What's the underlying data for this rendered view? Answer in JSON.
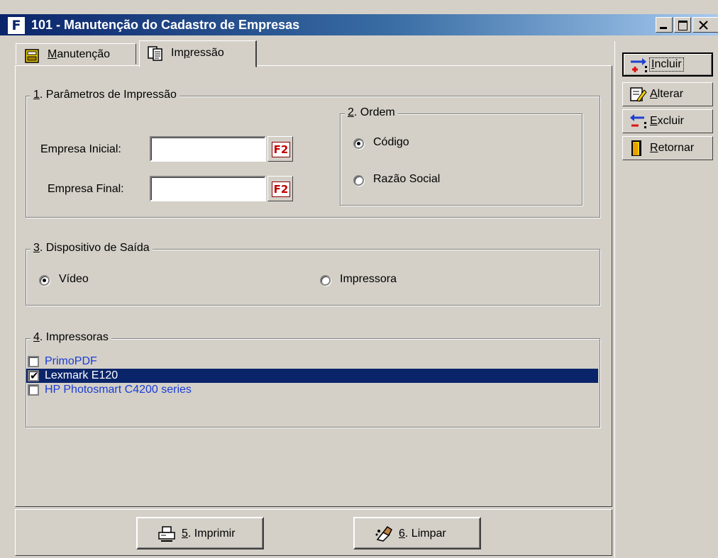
{
  "window": {
    "title": "101 - Manutenção do Cadastro de Empresas",
    "app_icon_letter": "F"
  },
  "tabs": [
    {
      "label_underlined": "M",
      "label_rest": "anutenção",
      "icon": "database-icon",
      "active": false
    },
    {
      "label_pre": "Im",
      "label_underlined": "p",
      "label_rest": "ressão",
      "icon": "documents-icon",
      "active": true
    }
  ],
  "params_group": {
    "legend_num": "1",
    "legend_rest": ". Parâmetros de Impressão",
    "empresa_inicial_label": "Empresa Inicial:",
    "empresa_inicial_value": "",
    "empresa_final_label": "Empresa Final:",
    "empresa_final_value": "",
    "lookup_button_label": "F2"
  },
  "ordem_group": {
    "legend_num": "2",
    "legend_rest": ". Ordem",
    "options": [
      {
        "label": "Código",
        "selected": true
      },
      {
        "label": "Razão Social",
        "selected": false
      }
    ]
  },
  "dispositivo_group": {
    "legend_num": "3",
    "legend_rest": ". Dispositivo de Saída",
    "options": [
      {
        "label": "Vídeo",
        "selected": true
      },
      {
        "label": "Impressora",
        "selected": false
      }
    ]
  },
  "impressoras_group": {
    "legend_num": "4",
    "legend_rest": ". Impressoras",
    "printers": [
      {
        "name": "PrimoPDF",
        "checked": false,
        "selected": false
      },
      {
        "name": "Lexmark E120",
        "checked": true,
        "selected": true
      },
      {
        "name": "HP Photosmart C4200 series",
        "checked": false,
        "selected": false
      }
    ]
  },
  "bottom_buttons": {
    "imprimir": {
      "num": "5",
      "rest": ". Imprimir",
      "icon": "printer-icon"
    },
    "limpar": {
      "num": "6",
      "rest": ". Limpar",
      "icon": "eraser-icon"
    }
  },
  "toolbar": {
    "incluir": {
      "underlined": "I",
      "rest": "ncluir",
      "icon": "insert-icon"
    },
    "alterar": {
      "underlined": "A",
      "rest": "lterar",
      "icon": "edit-icon"
    },
    "excluir": {
      "underlined": "E",
      "rest": "xcluir",
      "icon": "delete-icon"
    },
    "retornar": {
      "underlined": "R",
      "rest": "etornar",
      "icon": "exit-door-icon"
    }
  },
  "colors": {
    "title_bar_start": "#0a246a",
    "selection": "#0a246a",
    "list_text": "#1a3cd6",
    "f2_text": "#c00000"
  }
}
